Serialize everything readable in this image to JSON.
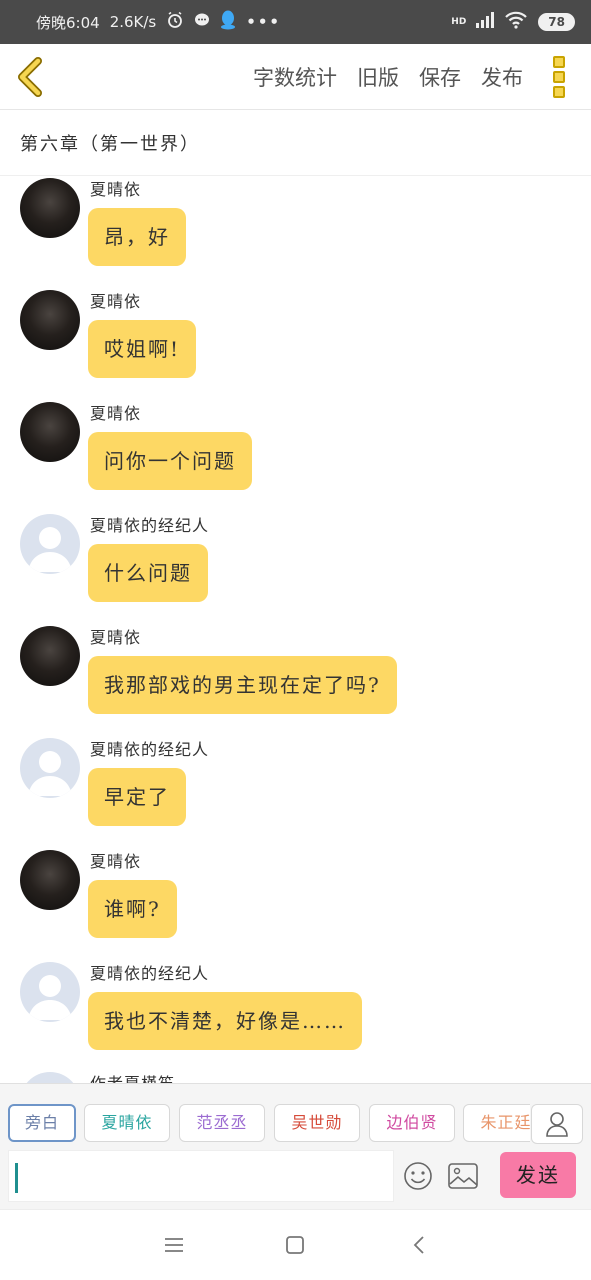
{
  "status_bar": {
    "carrier_time": "傍晚6:04",
    "net_speed": "2.6K/s",
    "network_badge": "HD",
    "battery": "78",
    "more": "•••"
  },
  "toolbar": {
    "word_count": "字数统计",
    "old_version": "旧版",
    "save": "保存",
    "publish": "发布"
  },
  "chapter_title": "第六章（第一世界）",
  "messages": [
    {
      "speaker": "夏晴依",
      "text": "昂，好",
      "avatar": "photo"
    },
    {
      "speaker": "夏晴依",
      "text": "哎姐啊!",
      "avatar": "photo"
    },
    {
      "speaker": "夏晴依",
      "text": "问你一个问题",
      "avatar": "photo"
    },
    {
      "speaker": "夏晴依的经纪人",
      "text": "什么问题",
      "avatar": "default"
    },
    {
      "speaker": "夏晴依",
      "text": "我那部戏的男主现在定了吗?",
      "avatar": "photo"
    },
    {
      "speaker": "夏晴依的经纪人",
      "text": "早定了",
      "avatar": "default"
    },
    {
      "speaker": "夏晴依",
      "text": "谁啊?",
      "avatar": "photo"
    },
    {
      "speaker": "夏晴依的经纪人",
      "text": "我也不清楚，好像是……",
      "avatar": "default"
    },
    {
      "speaker": "作者夏槿笙",
      "text": "",
      "avatar": "default"
    }
  ],
  "roles": [
    {
      "label": "旁白",
      "color": "#6b7fa8"
    },
    {
      "label": "夏晴依",
      "color": "#2aa5a0"
    },
    {
      "label": "范丞丞",
      "color": "#9b6bd1"
    },
    {
      "label": "吴世勋",
      "color": "#d64b3a"
    },
    {
      "label": "边伯贤",
      "color": "#d04aa0"
    },
    {
      "label": "朱正廷",
      "color": "#e8956a"
    }
  ],
  "composer": {
    "send_label": "发送",
    "input_value": ""
  },
  "colors": {
    "bubble": "#fdd864",
    "send": "#f87aa6",
    "status_bar": "#4a4a4a"
  }
}
